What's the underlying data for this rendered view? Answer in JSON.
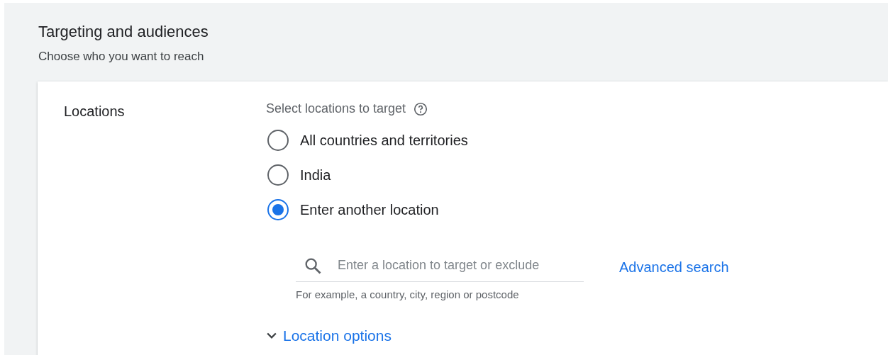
{
  "header": {
    "title": "Targeting and audiences",
    "subtitle": "Choose who you want to reach"
  },
  "locations": {
    "label": "Locations",
    "prompt": "Select locations to target",
    "options": [
      {
        "label": "All countries and territories",
        "selected": false
      },
      {
        "label": "India",
        "selected": false
      },
      {
        "label": "Enter another location",
        "selected": true
      }
    ],
    "search": {
      "placeholder": "Enter a location to target or exclude",
      "hint": "For example, a country, city, region or postcode",
      "link": "Advanced search"
    },
    "options_toggle": {
      "label": "Location options",
      "expanded": false
    }
  }
}
